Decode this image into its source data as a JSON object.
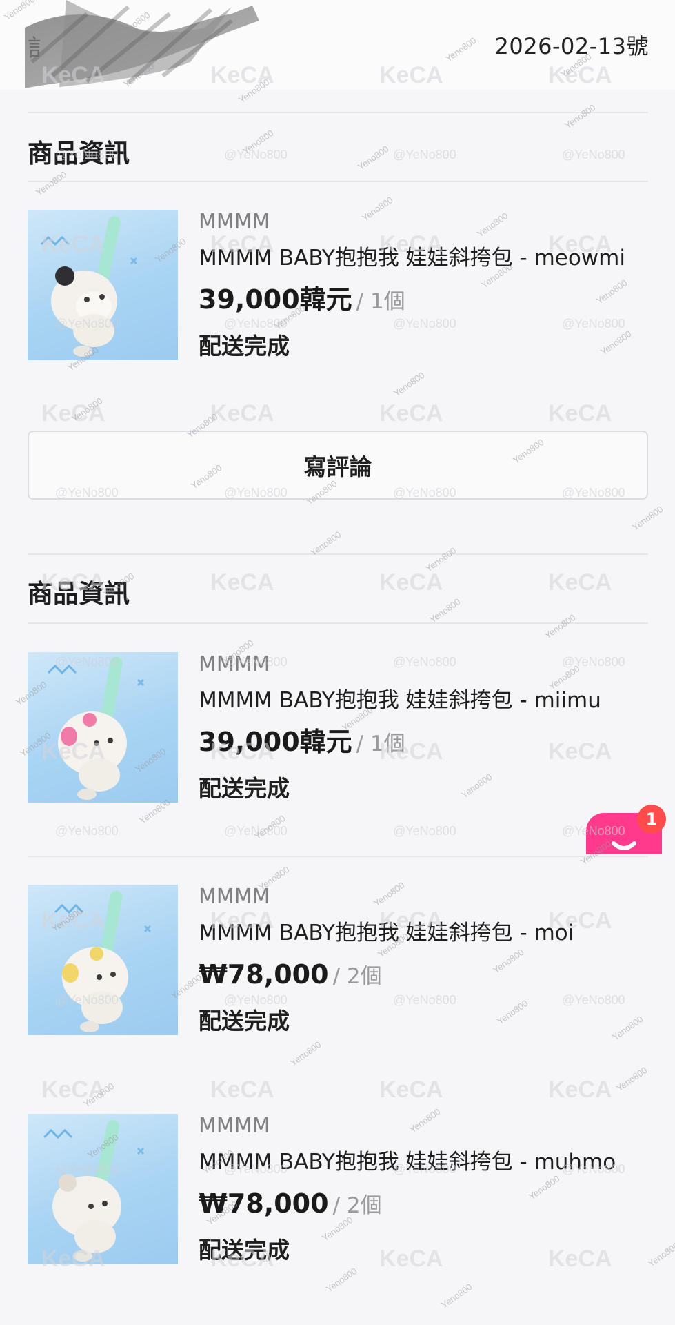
{
  "header": {
    "left_fragment": "訁",
    "date": "2026-02-13號"
  },
  "sections": [
    {
      "title": "商品資訊",
      "items": [
        {
          "brand": "MMMM",
          "name": "MMMM BABY抱抱我 娃娃斜挎包 - meowmi",
          "price": "39,000韓元",
          "qty": "/ 1個",
          "status": "配送完成",
          "ear_color": "#2f2f33"
        }
      ],
      "review_button": "寫評論"
    },
    {
      "title": "商品資訊",
      "items": [
        {
          "brand": "MMMM",
          "name": "MMMM BABY抱抱我 娃娃斜挎包 - miimu",
          "price": "39,000韓元",
          "qty": "/ 1個",
          "status": "配送完成",
          "ear_color": "#f07aa8"
        },
        {
          "brand": "MMMM",
          "name": "MMMM BABY抱抱我 娃娃斜挎包 - moi",
          "price": "₩78,000",
          "qty": "/ 2個",
          "status": "配送完成",
          "ear_color": "#f1d66a"
        },
        {
          "brand": "MMMM",
          "name": "MMMM BABY抱抱我 娃娃斜挎包 - muhmo",
          "price": "₩78,000",
          "qty": "/ 2個",
          "status": "配送完成",
          "ear_color": "#e3dcd2"
        }
      ]
    }
  ],
  "chat": {
    "badge_count": "1",
    "icon": "chat-icon"
  },
  "watermarks": {
    "brand_mark": "KeCA",
    "handle": "@YeNo800",
    "tag": "Yeno800"
  }
}
